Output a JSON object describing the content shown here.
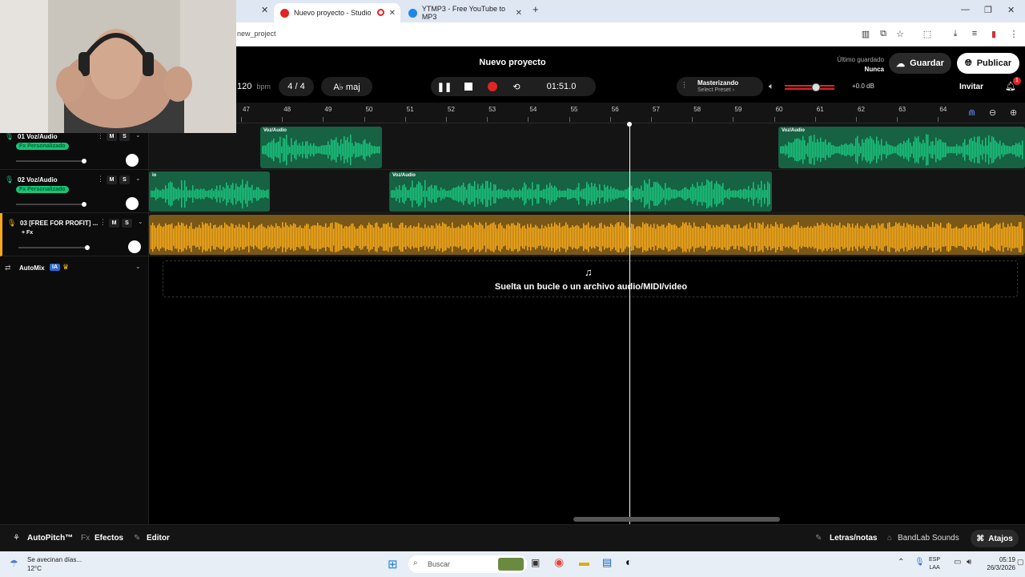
{
  "browser": {
    "tabs": [
      {
        "label": "Nuevo proyecto - Studio",
        "active": true
      },
      {
        "label": "YTMP3 - Free YouTube to MP3",
        "active": false
      }
    ],
    "url": "new_project",
    "new_tab_label": "+"
  },
  "app": {
    "project_title": "Nuevo proyecto",
    "last_saved_label": "Último guardado",
    "last_saved_value": "Nunca",
    "save_button": "Guardar",
    "publish_button": "Publicar",
    "bpm_value": "120",
    "bpm_unit": "bpm",
    "time_signature": "4 / 4",
    "key": "A♭ maj",
    "timecode": "01:51.0",
    "mastering_label": "Masterizando",
    "mastering_preset": "Select Preset ›",
    "volume_db": "+0.0 dB",
    "volume_level": 0.65,
    "invite_button": "Invitar",
    "notification_count": "1",
    "accent_color": "#e02525"
  },
  "ruler": {
    "bars": [
      "47",
      "48",
      "49",
      "50",
      "51",
      "52",
      "53",
      "54",
      "55",
      "56",
      "57",
      "58",
      "59",
      "60",
      "61",
      "62",
      "63",
      "64"
    ]
  },
  "tracks": [
    {
      "number_name": "01 Voz/Audio",
      "fx_label": "Fx Personalizado",
      "mute": "M",
      "solo": "S",
      "color": "#19c27c",
      "volume_level": 0.95,
      "clips": [
        {
          "label": "Voz/Audio"
        },
        {
          "label": "Voz/Audio"
        }
      ]
    },
    {
      "number_name": "02 Voz/Audio",
      "fx_label": "Fx Personalizado",
      "mute": "M",
      "solo": "S",
      "color": "#19c27c",
      "volume_level": 0.95,
      "clips": [
        {
          "label": "io"
        },
        {
          "label": "Voz/Audio"
        }
      ]
    },
    {
      "number_name": "03 [FREE FOR PROFIT] ...",
      "fx_label": "+ Fx",
      "mute": "M",
      "solo": "S",
      "color": "#f5a91a",
      "volume_level": 0.96,
      "clips": [
        {
          "label": ""
        }
      ]
    }
  ],
  "automix": {
    "label": "AutoMix",
    "badge": "IA"
  },
  "dropzone": {
    "text": "Suelta un bucle o un archivo audio/MIDI/video"
  },
  "bottom_bar": {
    "autopitch": "AutoPitch™",
    "effects_icon": "Fx",
    "effects": "Efectos",
    "editor": "Editor",
    "lyrics": "Letras/notas",
    "sounds": "BandLab Sounds",
    "shortcuts": "Atajos"
  },
  "taskbar": {
    "weather_text": "Se avecinan días...",
    "weather_temp": "12°C",
    "search_placeholder": "Buscar",
    "lang_1": "ESP",
    "lang_2": "LAA",
    "time": "05:19",
    "date": "26/3/2026"
  }
}
